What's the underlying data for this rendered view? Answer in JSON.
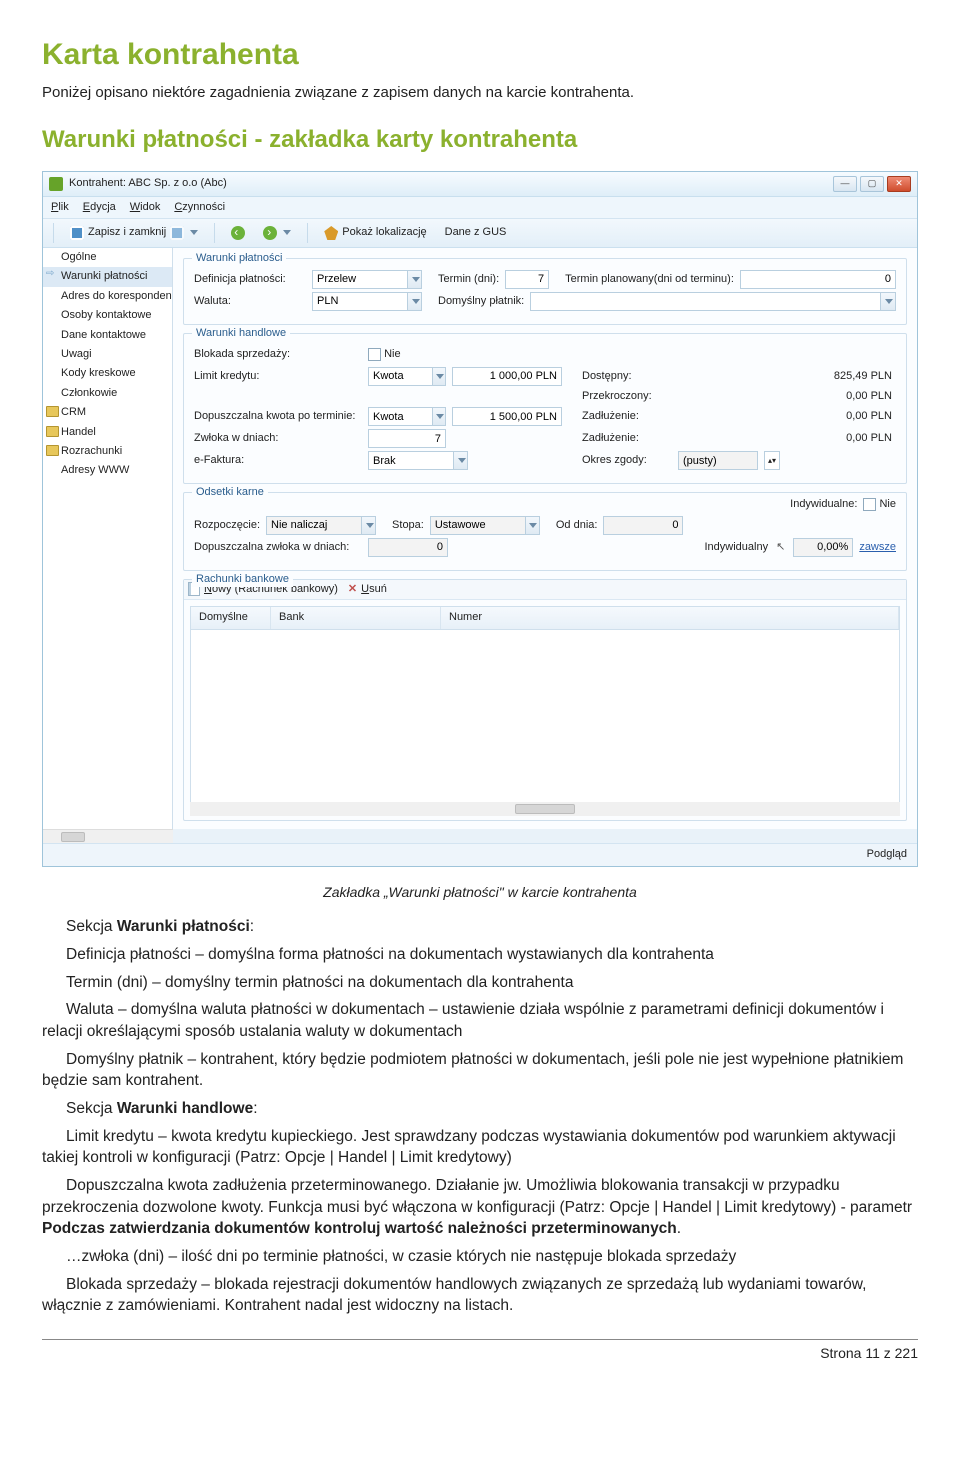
{
  "doc": {
    "title": "Karta kontrahenta",
    "subtitle": "Poniżej opisano niektóre zagadnienia związane z zapisem danych na karcie kontrahenta.",
    "section_heading": "Warunki płatności - zakładka karty kontrahenta"
  },
  "app": {
    "window_title": "Kontrahent: ABC Sp. z o.o (Abc)",
    "menu": {
      "plik": "Plik",
      "edycja": "Edycja",
      "widok": "Widok",
      "czynnosci": "Czynności"
    },
    "toolbar": {
      "save_close": "Zapisz i zamknij",
      "show_location": "Pokaż lokalizację",
      "gus": "Dane z GUS"
    },
    "sidebar": {
      "items": [
        "Ogólne",
        "Warunki płatności",
        "Adres do korespondenc",
        "Osoby kontaktowe",
        "Dane kontaktowe",
        "Uwagi",
        "Kody kreskowe",
        "Członkowie",
        "CRM",
        "Handel",
        "Rozrachunki",
        "Adresy WWW"
      ]
    },
    "panels": {
      "pay_terms": {
        "legend": "Warunki płatności",
        "def_label": "Definicja płatności:",
        "def_value": "Przelew",
        "term_label": "Termin (dni):",
        "term_value": "7",
        "planned_label": "Termin planowany(dni od terminu):",
        "planned_value": "0",
        "currency_label": "Waluta:",
        "currency_value": "PLN",
        "default_payer_label": "Domyślny płatnik:"
      },
      "trade_terms": {
        "legend": "Warunki handlowe",
        "block_label": "Blokada sprzedaży:",
        "block_value": "Nie",
        "limit_label": "Limit kredytu:",
        "limit_mode": "Kwota",
        "limit_value": "1 000,00 PLN",
        "avail_label": "Dostępny:",
        "avail_value": "825,49 PLN",
        "exceeded_label": "Przekroczony:",
        "exceeded_value": "0,00 PLN",
        "allow_label": "Dopuszczalna kwota po terminie:",
        "allow_mode": "Kwota",
        "allow_value": "1 500,00 PLN",
        "debt_label": "Zadłużenie:",
        "debt_value": "0,00 PLN",
        "delay_label": "Zwłoka w dniach:",
        "delay_value": "7",
        "debt2_label": "Zadłużenie:",
        "debt2_value": "0,00 PLN",
        "efaktura_label": "e-Faktura:",
        "efaktura_value": "Brak",
        "consent_label": "Okres zgody:",
        "consent_value": "(pusty)"
      },
      "penalties": {
        "legend": "Odsetki karne",
        "indiv_label": "Indywidualne:",
        "indiv_value": "Nie",
        "start_label": "Rozpoczęcie:",
        "start_value": "Nie naliczaj",
        "rate_label": "Stopa:",
        "rate_value": "Ustawowe",
        "from_label": "Od dnia:",
        "from_value": "0",
        "delay_label": "Dopuszczalna zwłoka w dniach:",
        "delay_value": "0",
        "indiv2_label": "Indywidualny",
        "indiv2_pct": "0,00%",
        "always": "zawsze"
      },
      "banks": {
        "legend": "Rachunki bankowe",
        "new": "Nowy (Rachunek bankowy)",
        "del": "Usuń",
        "col_default": "Domyślne",
        "col_bank": "Bank",
        "col_number": "Numer"
      }
    },
    "statusbar": "Podgląd"
  },
  "caption": "Zakładka „Warunki płatności\" w karcie kontrahenta",
  "prose": {
    "sekcja_wp": "Sekcja Warunki płatności:",
    "p1": "Definicja płatności – domyślna forma płatności na dokumentach wystawianych dla kontrahenta",
    "p2": "Termin (dni) – domyślny termin płatności na dokumentach dla kontrahenta",
    "p3": "Waluta – domyślna waluta płatności w dokumentach – ustawienie działa wspólnie z parametrami definicji dokumentów i relacji określającymi sposób ustalania waluty w dokumentach",
    "p4": "Domyślny płatnik – kontrahent, który będzie podmiotem płatności w dokumentach, jeśli pole nie jest wypełnione płatnikiem będzie sam kontrahent.",
    "sekcja_wh": "Sekcja Warunki handlowe:",
    "p5": "Limit kredytu – kwota kredytu kupieckiego. Jest sprawdzany podczas wystawiania dokumentów pod warunkiem aktywacji takiej kontroli w konfiguracji (Patrz: Opcje | Handel | Limit kredytowy)",
    "p6": "Dopuszczalna kwota zadłużenia przeterminowanego. Działanie jw. Umożliwia blokowania transakcji w przypadku przekroczenia dozwolone kwoty. Funkcja musi być włączona w konfiguracji (Patrz: Opcje | Handel | Limit kredytowy) - parametr Podczas zatwierdzania dokumentów kontroluj wartość należności przeterminowanych.",
    "p7": "…zwłoka (dni) – ilość dni po terminie płatności, w czasie których nie następuje blokada sprzedaży",
    "p8": "Blokada sprzedaży – blokada rejestracji dokumentów handlowych związanych ze sprzedażą lub wydaniami towarów, włącznie z zamówieniami. Kontrahent nadal jest widoczny na listach."
  },
  "footer": "Strona 11 z 221"
}
